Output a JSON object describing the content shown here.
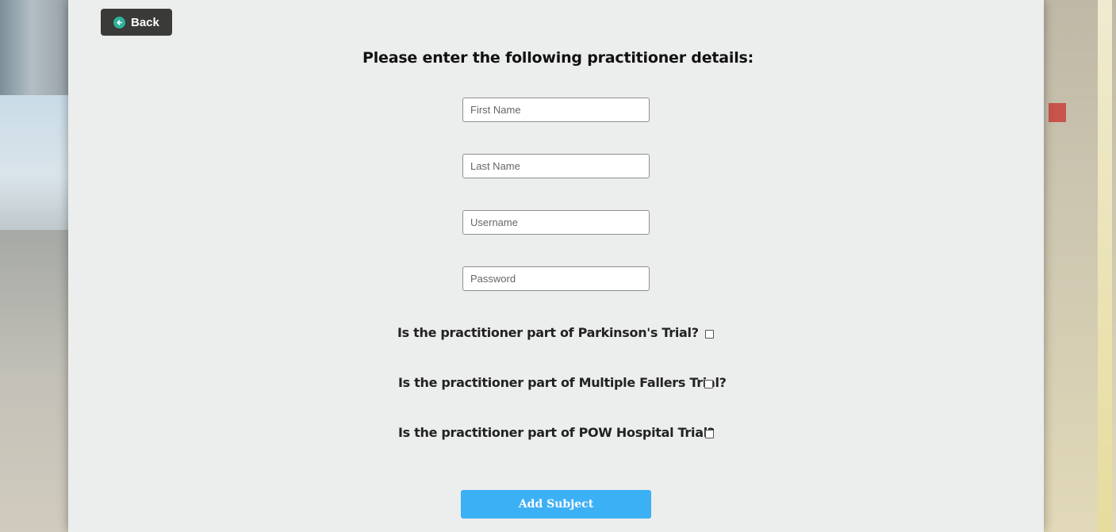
{
  "header": {
    "back_label": "Back",
    "back_icon": "back-arrow-circle-icon"
  },
  "form": {
    "title": "Please enter the following practitioner details:",
    "fields": {
      "first_name": {
        "placeholder": "First Name",
        "value": ""
      },
      "last_name": {
        "placeholder": "Last Name",
        "value": ""
      },
      "username": {
        "placeholder": "Username",
        "value": ""
      },
      "password": {
        "placeholder": "Password",
        "value": ""
      }
    },
    "trials": [
      {
        "label": "Is the practitioner part of Parkinson's Trial?",
        "checked": false
      },
      {
        "label": "Is the practitioner part of Multiple Fallers Trial?",
        "checked": false
      },
      {
        "label": "Is the practitioner part of POW Hospital Trial?",
        "checked": false
      }
    ],
    "submit_label": "Add Subject"
  },
  "colors": {
    "back_button_bg": "#3a3a38",
    "back_icon_accent": "#2db39a",
    "submit_button_bg": "#3cb0f5",
    "panel_bg": "#f1f1f1"
  }
}
